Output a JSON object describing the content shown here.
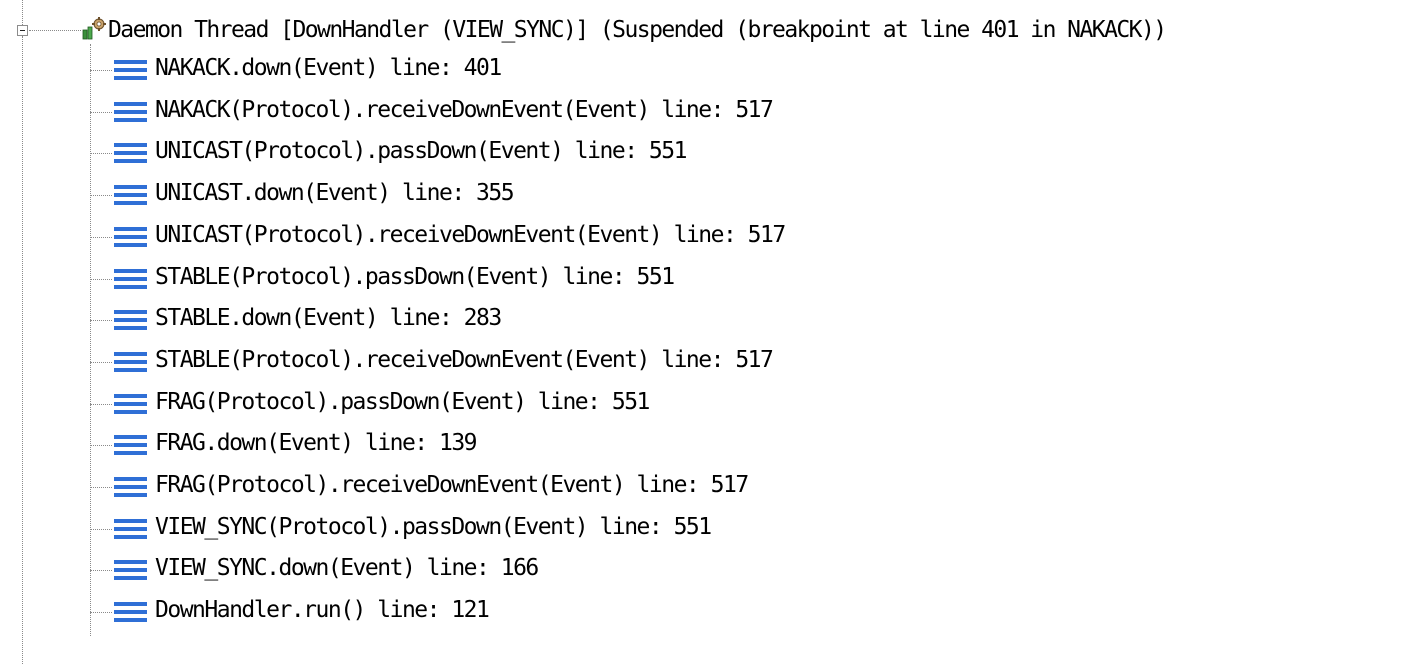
{
  "thread": {
    "label": "Daemon Thread [DownHandler (VIEW_SYNC)] (Suspended (breakpoint at line 401 in NAKACK))",
    "icon": "gear-thread-icon",
    "expanded": true
  },
  "frames": [
    {
      "label": "NAKACK.down(Event) line: 401",
      "icon": "stack-frame-icon"
    },
    {
      "label": "NAKACK(Protocol).receiveDownEvent(Event) line: 517",
      "icon": "stack-frame-icon"
    },
    {
      "label": "UNICAST(Protocol).passDown(Event) line: 551",
      "icon": "stack-frame-icon"
    },
    {
      "label": "UNICAST.down(Event) line: 355",
      "icon": "stack-frame-icon"
    },
    {
      "label": "UNICAST(Protocol).receiveDownEvent(Event) line: 517",
      "icon": "stack-frame-icon"
    },
    {
      "label": "STABLE(Protocol).passDown(Event) line: 551",
      "icon": "stack-frame-icon"
    },
    {
      "label": "STABLE.down(Event) line: 283",
      "icon": "stack-frame-icon"
    },
    {
      "label": "STABLE(Protocol).receiveDownEvent(Event) line: 517",
      "icon": "stack-frame-icon"
    },
    {
      "label": "FRAG(Protocol).passDown(Event) line: 551",
      "icon": "stack-frame-icon"
    },
    {
      "label": "FRAG.down(Event) line: 139",
      "icon": "stack-frame-icon"
    },
    {
      "label": "FRAG(Protocol).receiveDownEvent(Event) line: 517",
      "icon": "stack-frame-icon"
    },
    {
      "label": "VIEW_SYNC(Protocol).passDown(Event) line: 551",
      "icon": "stack-frame-icon"
    },
    {
      "label": "VIEW_SYNC.down(Event) line: 166",
      "icon": "stack-frame-icon"
    },
    {
      "label": "DownHandler.run() line: 121",
      "icon": "stack-frame-icon"
    }
  ],
  "colors": {
    "frame_icon": "#2f6fd6",
    "tree_line": "#8a8a8a",
    "text": "#000000",
    "background": "#ffffff"
  }
}
